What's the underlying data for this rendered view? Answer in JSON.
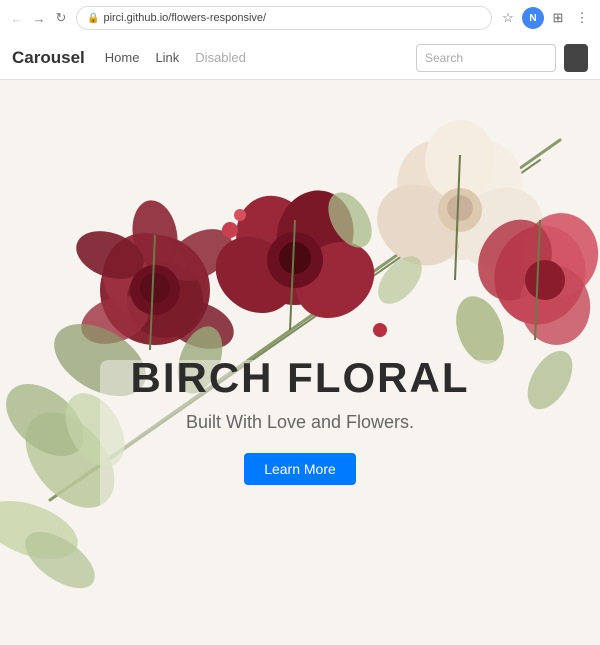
{
  "browser": {
    "url": "pirci.github.io/flowers-responsive/",
    "nav": {
      "back_label": "←",
      "forward_label": "→",
      "reload_label": "↻",
      "home_label": "⌂"
    },
    "icons": {
      "bookmark_label": "☆",
      "extensions_label": "🧩",
      "profile_label": "N",
      "menu_label": "⋮"
    }
  },
  "site": {
    "navbar": {
      "brand": "Carousel",
      "links": [
        {
          "label": "Home",
          "active": true,
          "disabled": false
        },
        {
          "label": "Link",
          "active": false,
          "disabled": false
        },
        {
          "label": "Disabled",
          "active": false,
          "disabled": true
        }
      ],
      "search_placeholder": "Search",
      "button_label": ""
    },
    "hero": {
      "title": "BIRCH FLORAL",
      "subtitle": "Built With Love and Flowers.",
      "cta_label": "Learn More"
    }
  }
}
